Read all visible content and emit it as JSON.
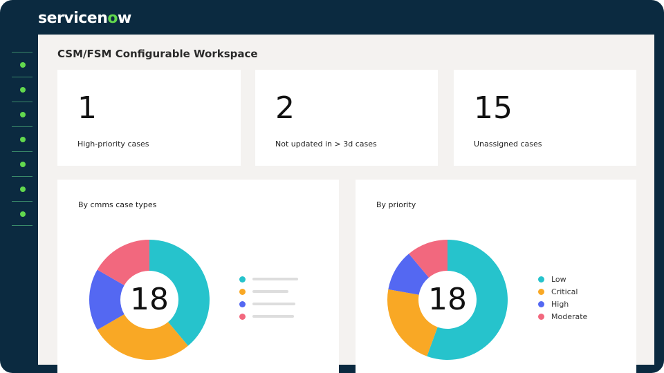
{
  "brand": {
    "pre": "servicen",
    "o": "o",
    "post": "w"
  },
  "sidebar": {
    "items": 7
  },
  "page_title": "CSM/FSM Configurable Workspace",
  "kpis": [
    {
      "value": "1",
      "label": "High-priority cases"
    },
    {
      "value": "2",
      "label": "Not updated in > 3d cases"
    },
    {
      "value": "15",
      "label": "Unassigned cases"
    }
  ],
  "colors": {
    "teal": "#26c3cc",
    "orange": "#f9a825",
    "blue": "#5468f2",
    "pink": "#f2687e"
  },
  "chart_data": [
    {
      "type": "pie",
      "title": "By cmms case types",
      "total": "18",
      "labels": [
        "",
        "",
        "",
        ""
      ],
      "values": [
        7,
        5,
        3,
        3
      ],
      "colors": [
        "#26c3cc",
        "#f9a825",
        "#5468f2",
        "#f2687e"
      ]
    },
    {
      "type": "pie",
      "title": "By priority",
      "total": "18",
      "labels": [
        "Low",
        "Critical",
        "High",
        "Moderate"
      ],
      "values": [
        10,
        4,
        2,
        2
      ],
      "colors": [
        "#26c3cc",
        "#f9a825",
        "#5468f2",
        "#f2687e"
      ]
    }
  ]
}
